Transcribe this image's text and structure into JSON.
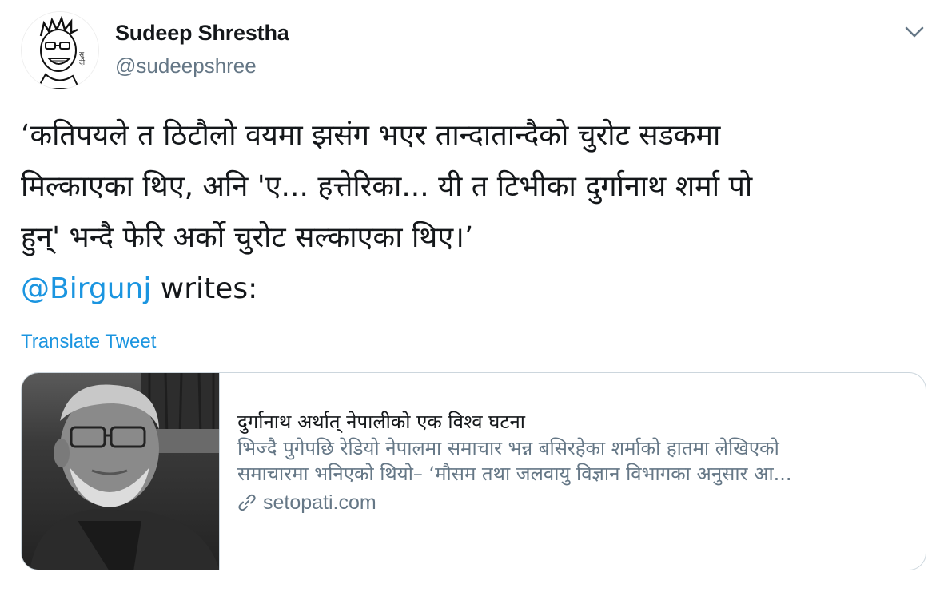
{
  "author": {
    "display_name": "Sudeep Shrestha",
    "handle": "@sudeepshree"
  },
  "tweet": {
    "lines": [
      "‘कतिपयले त ठिटौलो वयमा झसंग भएर तान्दातान्दैको चुरोट सडकमा",
      "मिल्काएका थिए, अनि 'ए... हत्तेरिका... यी त टिभीका दुर्गानाथ शर्मा पो",
      "हुन्' भन्दै फेरि अर्को चुरोट सल्काएका थिए।’"
    ],
    "mention": "@Birgunj",
    "mention_suffix": " writes:",
    "translate_label": "Translate Tweet"
  },
  "card": {
    "title": "दुर्गानाथ अर्थात् नेपालीको एक विश्व घटना",
    "description_lines": [
      "भिज्दै पुगेपछि रेडियो नेपालमा समाचार भन्न बसिरहेका शर्माको हातमा लेखिएको",
      "समाचारमा भनिएको थियो– ‘मौसम तथा जलवायु विज्ञान विभागका अनुसार आ..."
    ],
    "domain": "setopati.com"
  },
  "icons": {
    "caret": "chevron-down-icon",
    "link": "link-icon"
  },
  "colors": {
    "accent": "#1b95e0",
    "secondary_text": "#657786",
    "border": "#ccd6dd"
  }
}
